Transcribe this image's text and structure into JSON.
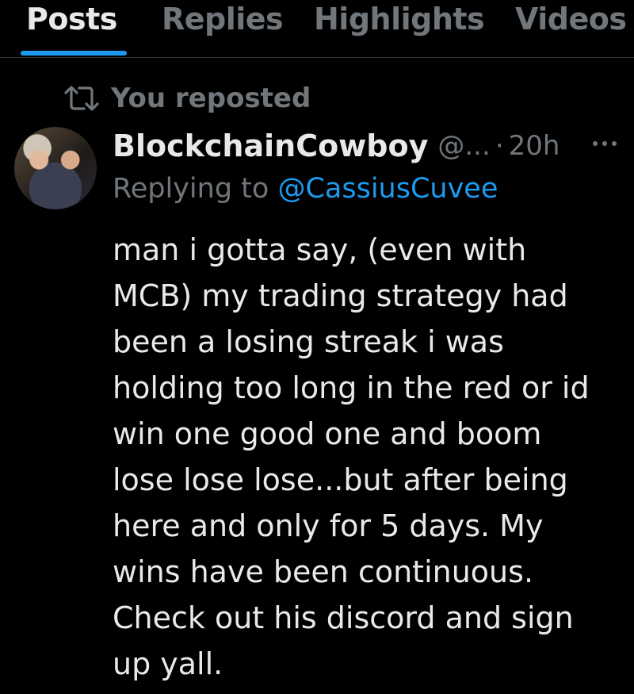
{
  "tabs": [
    {
      "label": "Posts",
      "active": true
    },
    {
      "label": "Replies",
      "active": false
    },
    {
      "label": "Highlights",
      "active": false
    },
    {
      "label": "Videos",
      "active": false
    }
  ],
  "repost": {
    "icon": "repost-icon",
    "label": "You reposted"
  },
  "post": {
    "display_name": "BlockchainCowboy",
    "handle": "@...",
    "separator": "·",
    "time": "20h",
    "more_icon": "more-options-icon",
    "reply_prefix": "Replying to",
    "reply_mention": "@CassiusCuvee",
    "body_lines": [
      "man i gotta say, (even with",
      "MCB) my trading strategy had",
      "been a losing streak i was",
      "holding too long in the red or id",
      "win one good one and boom",
      "lose lose lose...but after being",
      "here and only for 5 days. My",
      "wins have been continuous.",
      "Check out his discord and sign",
      "up yall."
    ]
  },
  "colors": {
    "background": "#000000",
    "text": "#e7e9ea",
    "muted": "#71767b",
    "accent": "#1d9bf0",
    "divider": "#2f3336"
  }
}
